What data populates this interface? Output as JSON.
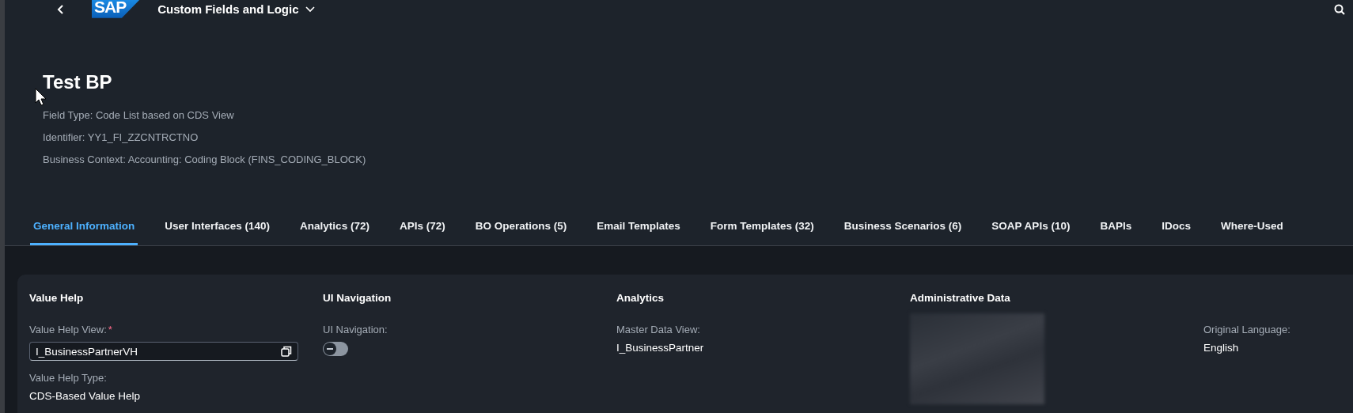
{
  "shell_bar": {
    "logo": "SAP",
    "app_title": "Custom Fields and Logic"
  },
  "header": {
    "title": "Test BP",
    "attributes": [
      "Field Type: Code List based on CDS View",
      "Identifier: YY1_FI_ZZCNTRCTNO",
      "Business Context: Accounting: Coding Block (FINS_CODING_BLOCK)"
    ]
  },
  "tabs": [
    {
      "label": "General Information",
      "selected": true
    },
    {
      "label": "User Interfaces (140)",
      "selected": false
    },
    {
      "label": "Analytics (72)",
      "selected": false
    },
    {
      "label": "APIs (72)",
      "selected": false
    },
    {
      "label": "BO Operations (5)",
      "selected": false
    },
    {
      "label": "Email Templates",
      "selected": false
    },
    {
      "label": "Form Templates (32)",
      "selected": false
    },
    {
      "label": "Business Scenarios (6)",
      "selected": false
    },
    {
      "label": "SOAP APIs (10)",
      "selected": false
    },
    {
      "label": "BAPIs",
      "selected": false
    },
    {
      "label": "IDocs",
      "selected": false
    },
    {
      "label": "Where-Used",
      "selected": false
    }
  ],
  "sections": [
    {
      "title": "Value Help",
      "fields": [
        {
          "kind": "input",
          "label": "Value Help View:",
          "required": true,
          "required_mark": "*",
          "value": "I_BusinessPartnerVH"
        },
        {
          "kind": "text",
          "label": "Value Help Type:",
          "value": "CDS-Based Value Help"
        }
      ]
    },
    {
      "title": "UI Navigation",
      "fields": [
        {
          "kind": "switch",
          "label": "UI Navigation:",
          "on": false
        }
      ]
    },
    {
      "title": "Analytics",
      "fields": [
        {
          "kind": "text",
          "label": "Master Data View:",
          "value": "I_BusinessPartner"
        }
      ]
    },
    {
      "title": "Administrative Data",
      "fields": [
        {
          "kind": "redacted"
        }
      ]
    },
    {
      "fields": [
        {
          "kind": "text",
          "label": "Original Language:",
          "value": "English"
        }
      ]
    }
  ]
}
